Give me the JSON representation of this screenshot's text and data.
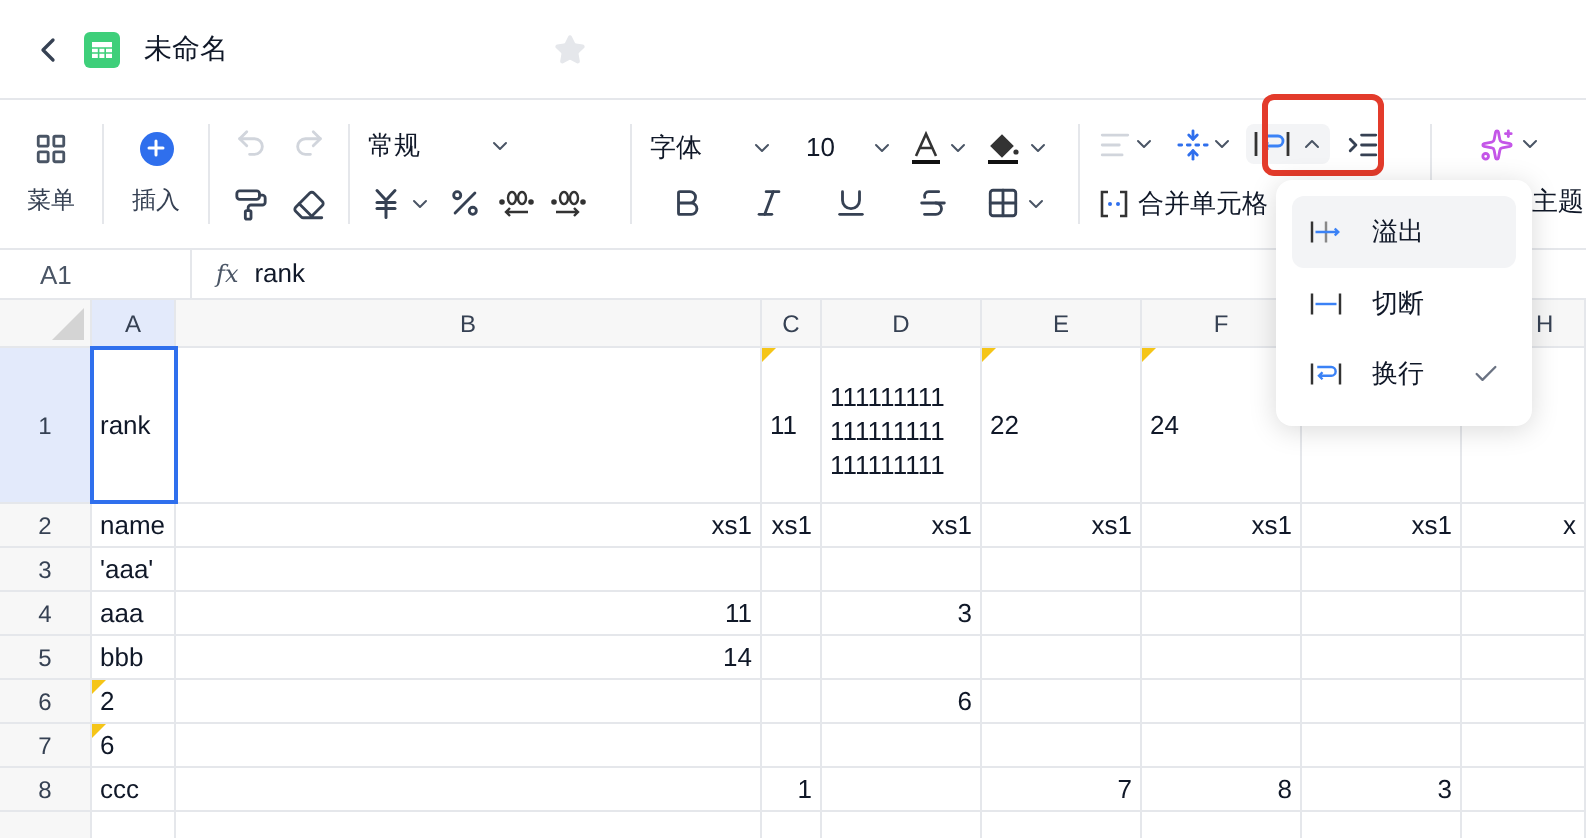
{
  "header": {
    "title": "未命名",
    "starred": false
  },
  "toolbar": {
    "menu": "菜单",
    "insert": "插入",
    "undo": {
      "disabled": true
    },
    "redo": {
      "disabled": true
    },
    "number_format": "常规",
    "font": "字体",
    "font_size": "10",
    "align": {
      "disabled": true
    },
    "merge": "合并单元格",
    "theme": "主题",
    "wrap_button": {
      "highlighted": true,
      "expanded": true
    }
  },
  "wrap_menu": [
    {
      "kind": "overflow",
      "label": "溢出",
      "selected": false,
      "hovered": true
    },
    {
      "kind": "clip",
      "label": "切断",
      "selected": false,
      "hovered": false
    },
    {
      "kind": "wrap",
      "label": "换行",
      "selected": true,
      "hovered": false
    }
  ],
  "formula_bar": {
    "cell": "A1",
    "fx_label": "fx",
    "formula": "rank"
  },
  "columns": [
    {
      "label": "A",
      "selected": true
    },
    {
      "label": "B",
      "selected": false
    },
    {
      "label": "C",
      "selected": false
    },
    {
      "label": "D",
      "selected": false
    },
    {
      "label": "E",
      "selected": false
    },
    {
      "label": "F",
      "selected": false
    },
    {
      "label": "H",
      "selected": false
    }
  ],
  "rows": [
    {
      "label": "1",
      "selected": true,
      "cells": [
        {
          "text": "rank",
          "right_aligned": false
        },
        null,
        {
          "text": "11",
          "right_aligned": false,
          "flagged": true
        },
        {
          "lines": [
            "111111111",
            "111111111",
            "111111111"
          ],
          "right_aligned": false
        },
        {
          "text": "22",
          "right_aligned": false,
          "flagged": true
        },
        {
          "text": "24",
          "right_aligned": false,
          "flagged": true
        },
        null,
        null
      ]
    },
    {
      "label": "2",
      "selected": false,
      "cells": [
        {
          "text": "name",
          "right_aligned": false
        },
        {
          "text": "xs1",
          "right_aligned": true
        },
        {
          "text": "xs1",
          "right_aligned": true
        },
        {
          "text": "xs1",
          "right_aligned": true
        },
        {
          "text": "xs1",
          "right_aligned": true
        },
        {
          "text": "xs1",
          "right_aligned": true
        },
        {
          "text": "xs1",
          "right_aligned": true
        },
        {
          "text": "x",
          "right_aligned": true
        }
      ]
    },
    {
      "label": "3",
      "selected": false,
      "cells": [
        {
          "text": "'aaa'",
          "right_aligned": false
        },
        null,
        null,
        null,
        null,
        null,
        null,
        null
      ]
    },
    {
      "label": "4",
      "selected": false,
      "cells": [
        {
          "text": "aaa",
          "right_aligned": false
        },
        {
          "text": "11",
          "right_aligned": true
        },
        null,
        {
          "text": "3",
          "right_aligned": true
        },
        null,
        null,
        null,
        null
      ]
    },
    {
      "label": "5",
      "selected": false,
      "cells": [
        {
          "text": "bbb",
          "right_aligned": false
        },
        {
          "text": "14",
          "right_aligned": true
        },
        null,
        null,
        null,
        null,
        null,
        null
      ]
    },
    {
      "label": "6",
      "selected": false,
      "cells": [
        {
          "text": "2",
          "right_aligned": false,
          "flagged": true
        },
        null,
        null,
        {
          "text": "6",
          "right_aligned": true
        },
        null,
        null,
        null,
        null
      ]
    },
    {
      "label": "7",
      "selected": false,
      "cells": [
        {
          "text": "6",
          "right_aligned": false,
          "flagged": true
        },
        null,
        null,
        null,
        null,
        null,
        null,
        null
      ]
    },
    {
      "label": "8",
      "selected": false,
      "cells": [
        {
          "text": "ccc",
          "right_aligned": false
        },
        null,
        {
          "text": "1",
          "right_aligned": true
        },
        null,
        {
          "text": "7",
          "right_aligned": true
        },
        {
          "text": "8",
          "right_aligned": true
        },
        {
          "text": "3",
          "right_aligned": true
        },
        null
      ]
    }
  ]
}
